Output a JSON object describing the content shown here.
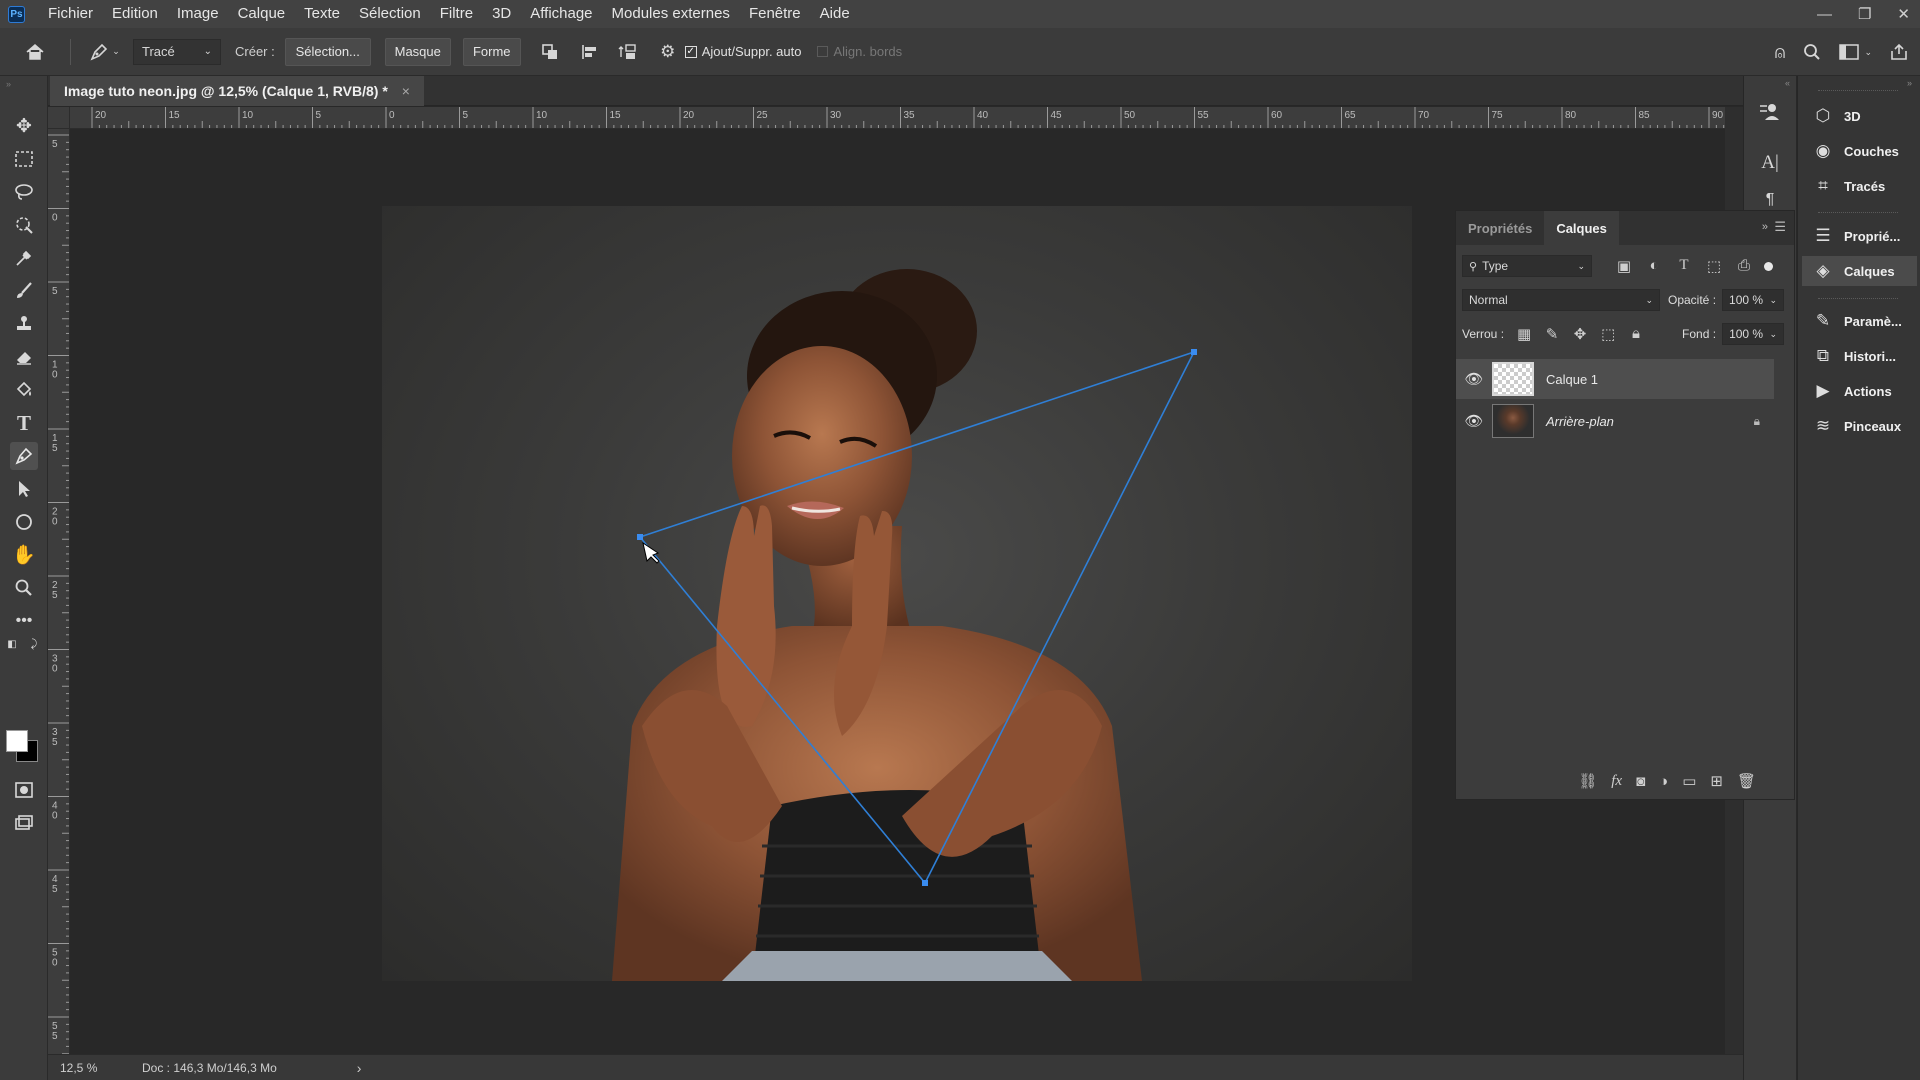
{
  "app": {
    "logo": "Ps"
  },
  "menu": [
    "Fichier",
    "Edition",
    "Image",
    "Calque",
    "Texte",
    "Sélection",
    "Filtre",
    "3D",
    "Affichage",
    "Modules externes",
    "Fenêtre",
    "Aide"
  ],
  "options_bar": {
    "mode_select": "Tracé",
    "create_label": "Créer :",
    "btn_selection": "Sélection...",
    "btn_masque": "Masque",
    "btn_forme": "Forme",
    "auto_add_label": "Ajout/Suppr. auto",
    "auto_add_checked": true,
    "align_edges_label": "Align. bords"
  },
  "document": {
    "tab_title": "Image tuto neon.jpg @ 12,5% (Calque 1, RVB/8) *",
    "close_glyph": "×"
  },
  "rulers": {
    "h_labels": [
      "20",
      "15",
      "10",
      "5",
      "0",
      "5",
      "10",
      "15",
      "20",
      "25",
      "30",
      "35",
      "40",
      "45",
      "50",
      "55",
      "60",
      "65",
      "70",
      "75",
      "80",
      "85",
      "90"
    ],
    "v_labels": [
      "5",
      "0",
      "5",
      "1 0",
      "1 5",
      "2 0",
      "2 5",
      "3 0",
      "3 5",
      "4 0",
      "4 5",
      "5 0",
      "5 5"
    ]
  },
  "status": {
    "zoom": "12,5 %",
    "doc_size": "Doc : 146,3 Mo/146,3 Mo",
    "arrow": "›"
  },
  "layers_panel": {
    "tabs": [
      "Propriétés",
      "Calques"
    ],
    "active_tab": "Calques",
    "filter_select": "Type",
    "blend_mode": "Normal",
    "opacity_label": "Opacité :",
    "opacity_value": "100 %",
    "lock_label": "Verrou :",
    "fill_label": "Fond :",
    "fill_value": "100 %",
    "layers": [
      {
        "name": "Calque 1",
        "selected": true,
        "locked": false
      },
      {
        "name": "Arrière-plan",
        "selected": false,
        "locked": true
      }
    ]
  },
  "dock": {
    "items": [
      "3D",
      "Couches",
      "Tracés",
      "Proprié...",
      "Calques",
      "Paramè...",
      "Histori...",
      "Actions",
      "Pinceaux"
    ],
    "active": "Calques"
  },
  "path": {
    "color": "#2f7fd6",
    "anchor_color": "#3a8cf0"
  }
}
